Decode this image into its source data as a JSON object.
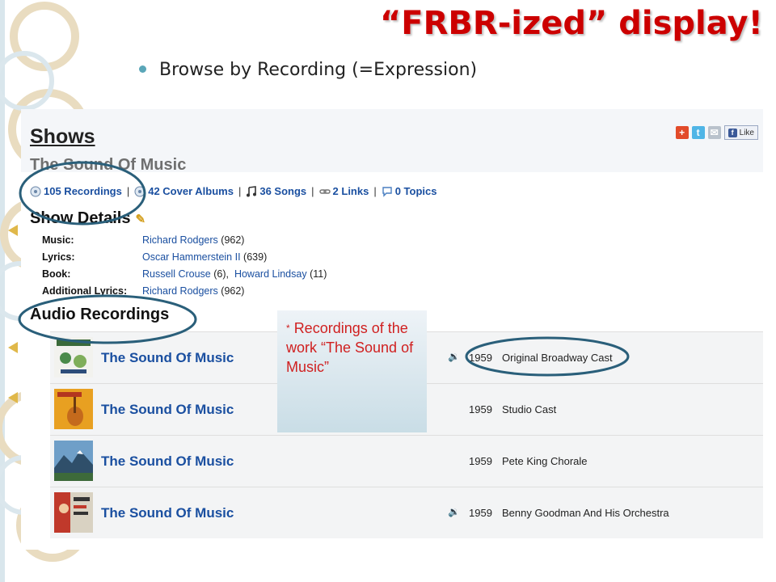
{
  "slide": {
    "title": "“FRBR-ized” display!",
    "bullet": "Browse by Recording (=Expression)"
  },
  "site": {
    "section_title": "Shows",
    "show_name": "The Sound Of Music",
    "share": {
      "like_label": "Like"
    },
    "tabs": [
      {
        "label": "105 Recordings",
        "icon": "record-icon"
      },
      {
        "label": "42 Cover Albums",
        "icon": "album-icon"
      },
      {
        "label": "36 Songs",
        "icon": "music-note-icon"
      },
      {
        "label": "2 Links",
        "icon": "link-icon"
      },
      {
        "label": "0 Topics",
        "icon": "speech-bubble-icon"
      }
    ],
    "tab_separator": "|",
    "details_title": "Show Details",
    "credits": [
      {
        "label": "Music:",
        "names": [
          {
            "name": "Richard Rodgers",
            "count": "(962)"
          }
        ]
      },
      {
        "label": "Lyrics:",
        "names": [
          {
            "name": "Oscar Hammerstein II",
            "count": "(639)"
          }
        ]
      },
      {
        "label": "Book:",
        "names": [
          {
            "name": "Russell Crouse",
            "count": "(6),"
          },
          {
            "name": "Howard Lindsay",
            "count": "(11)"
          }
        ]
      },
      {
        "label": "Additional Lyrics:",
        "names": [
          {
            "name": "Richard Rodgers",
            "count": "(962)"
          }
        ]
      }
    ],
    "audio_title": "Audio Recordings",
    "recordings": [
      {
        "title": "The Sound Of Music",
        "year": "1959",
        "cast": "Original Broadway Cast",
        "audio": true
      },
      {
        "title": "The Sound Of Music",
        "year": "1959",
        "cast": "Studio Cast",
        "audio": false
      },
      {
        "title": "The Sound Of Music",
        "year": "1959",
        "cast": "Pete King Chorale",
        "audio": false
      },
      {
        "title": "The Sound Of Music",
        "year": "1959",
        "cast": "Benny Goodman And His Orchestra",
        "audio": true
      }
    ]
  },
  "callout": {
    "star": "*",
    "text": "Recordings of the work “The Sound of Music”"
  },
  "colors": {
    "title_red": "#cc0000",
    "link_blue": "#1a4fa0",
    "annotation_blue": "#2a5f7a",
    "callout_text": "#d02020",
    "bullet_teal": "#5aa6b8"
  }
}
